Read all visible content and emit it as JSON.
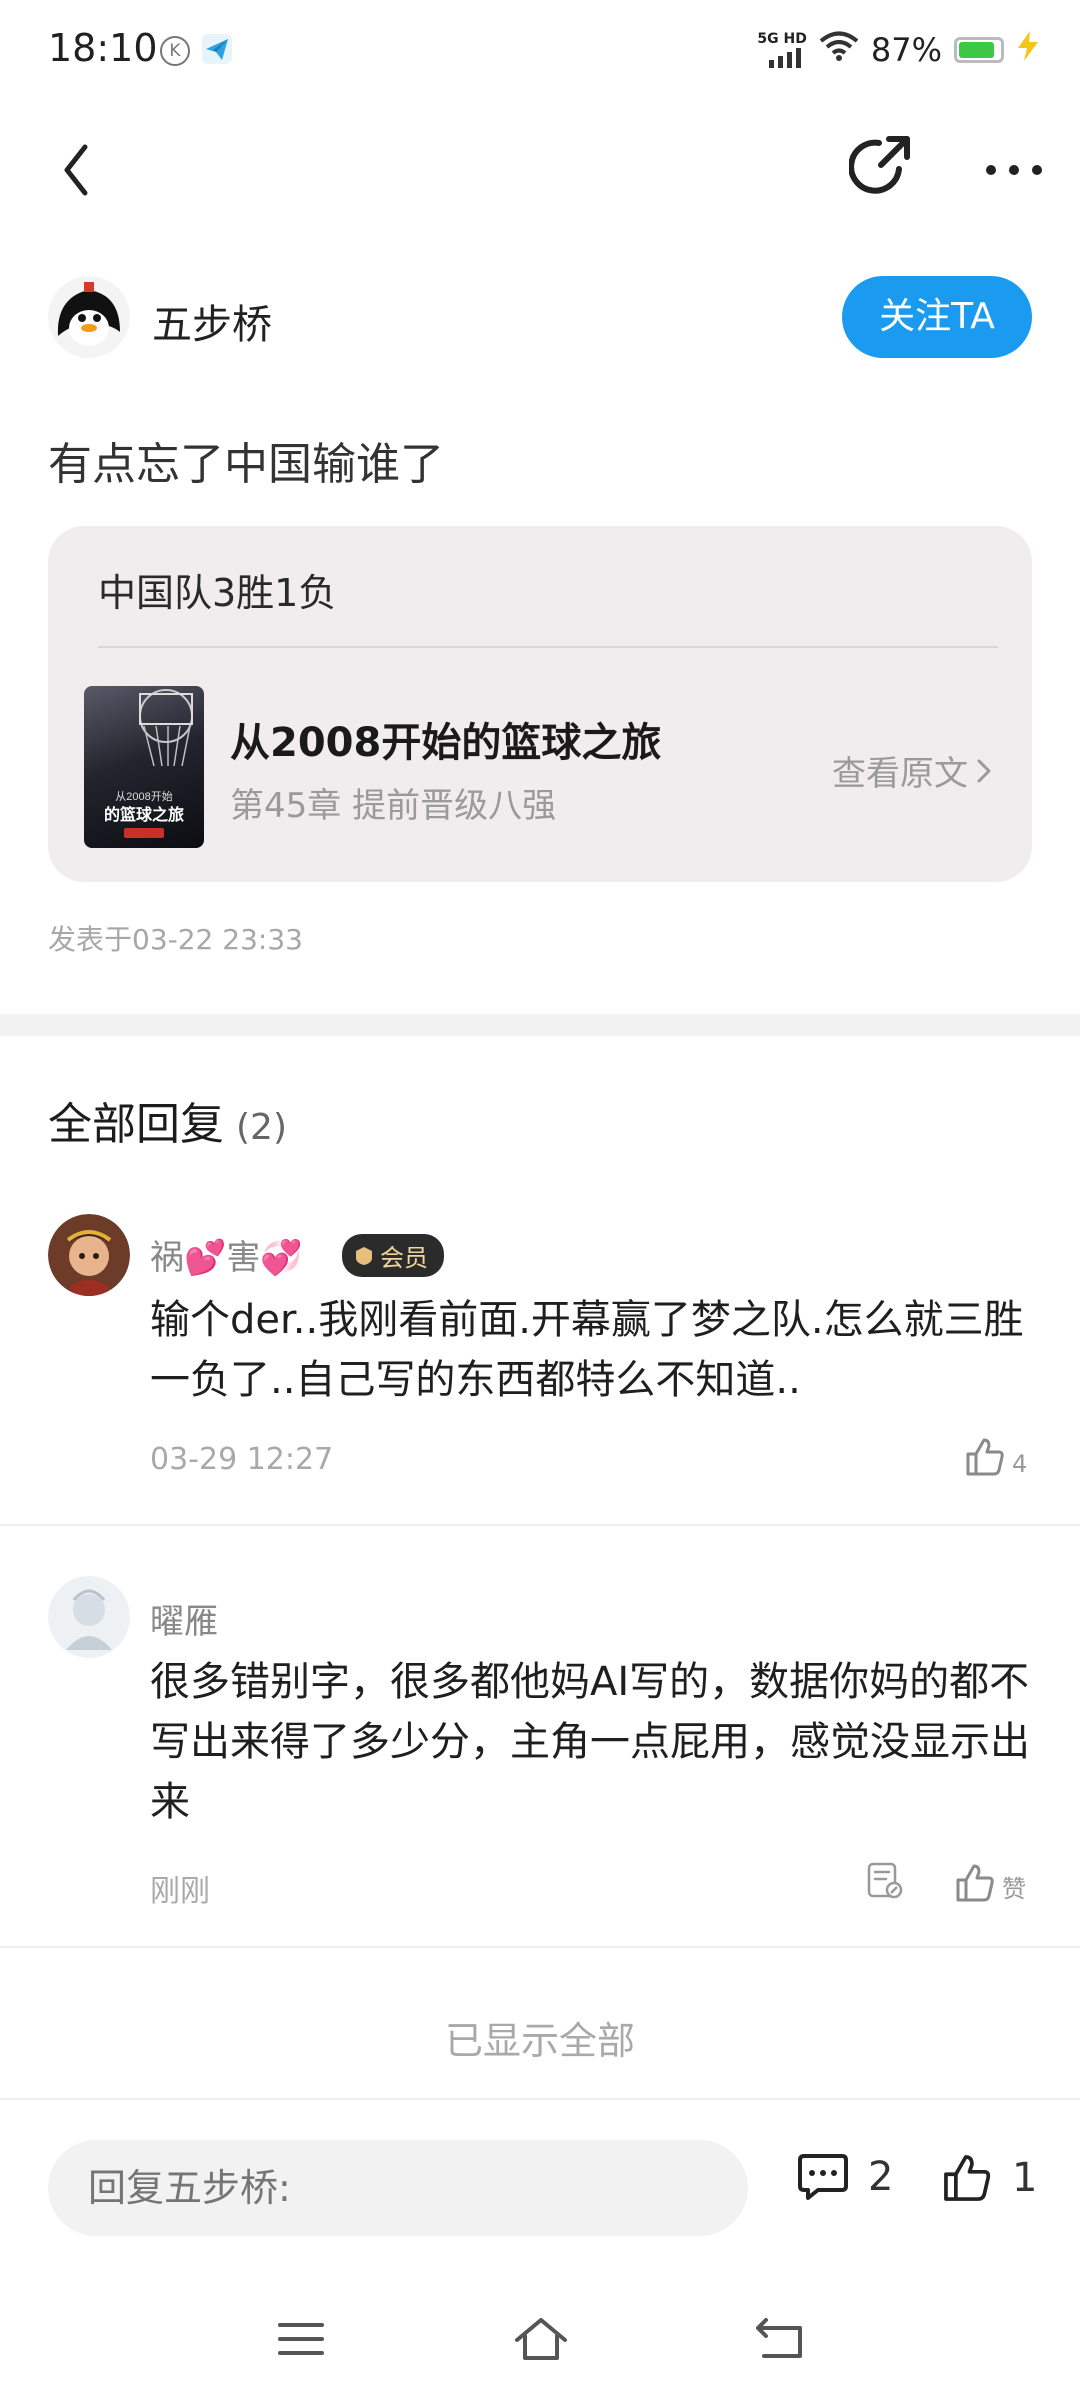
{
  "status_bar": {
    "time": "18:10",
    "k_icon_letter": "K",
    "network": "5G HD",
    "battery": "87%",
    "battery_level": 0.87,
    "battery_color": "#3cc845"
  },
  "header": {
    "back_icon": "back-arrow-icon",
    "share_icon": "share-icon",
    "more_icon": "more-icon"
  },
  "author": {
    "name": "五步桥",
    "follow_label": "关注TA"
  },
  "post": {
    "title": "有点忘了中国输谁了",
    "quote": "中国队3胜1负",
    "book": {
      "title": "从2008开始的篮球之旅",
      "chapter": "第45章 提前晋级八强",
      "view_original": "查看原文"
    },
    "time": "发表于03-22 23:33"
  },
  "replies": {
    "header": "全部回复",
    "count": "(2)",
    "items": [
      {
        "name": "祸💕害💞",
        "badge": "会员",
        "text": "输个der..我刚看前面.开幕赢了梦之队.怎么就三胜一负了..自己写的东西都特么不知道..",
        "time": "03-29 12:27",
        "likes": "4"
      },
      {
        "name": "曜雁",
        "text": "很多错别字，很多都他妈AI写的，数据你妈的都不写出来得了多少分，主角一点屁用，感觉没显示出来",
        "time": "刚刚",
        "likes": "赞"
      }
    ],
    "shown_all": "已显示全部"
  },
  "bottom_bar": {
    "reply_placeholder": "回复五步桥:",
    "comment_count": "2",
    "like_count": "1"
  },
  "colors": {
    "accent": "#1a9bf0",
    "quote_bg": "#f1ecee"
  }
}
